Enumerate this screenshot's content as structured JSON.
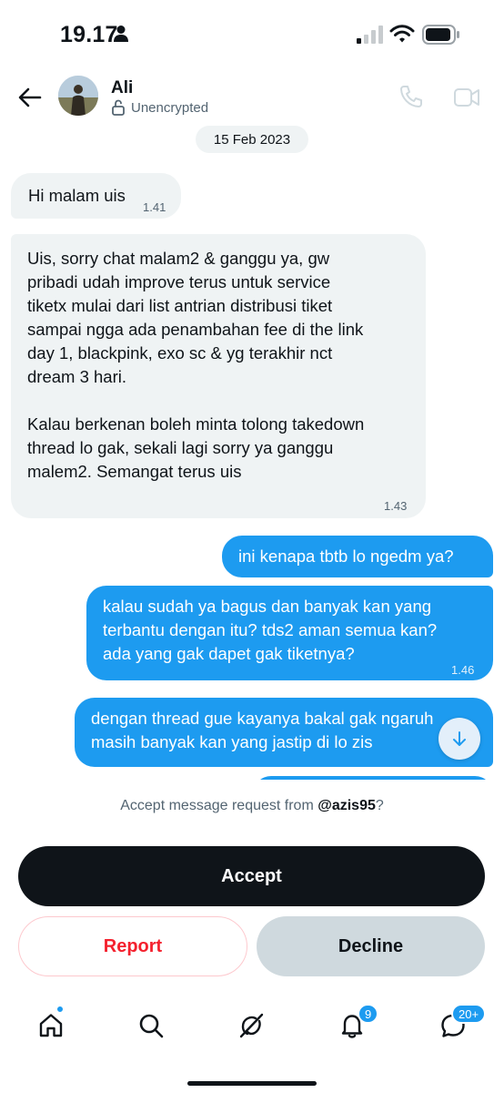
{
  "status_bar": {
    "time": "19.17",
    "icons": [
      "person-icon",
      "signal-icon",
      "wifi-icon",
      "battery-icon"
    ]
  },
  "header": {
    "name": "Ali",
    "encryption": "Unencrypted",
    "icons": [
      "back-arrow-icon",
      "avatar",
      "lock-icon",
      "phone-icon",
      "video-camera-icon"
    ]
  },
  "date_chip": "15 Feb 2023",
  "messages": [
    {
      "direction": "incoming",
      "text": "Hi malam uis",
      "time": "1.41"
    },
    {
      "direction": "incoming",
      "text": "Uis, sorry chat malam2 & ganggu ya, gw\npribadi udah improve terus untuk service\ntiketx mulai dari list antrian distribusi tiket\nsampai ngga ada penambahan fee di the link\nday 1, blackpink, exo sc & yg terakhir nct\ndream 3 hari.\n\nKalau berkenan boleh minta tolong takedown\nthread lo gak, sekali lagi sorry ya ganggu\nmalem2. Semangat terus uis",
      "time": "1.43"
    },
    {
      "direction": "outgoing",
      "text": "ini kenapa tbtb lo ngedm ya?",
      "time": ""
    },
    {
      "direction": "outgoing",
      "text": "kalau sudah ya bagus dan banyak kan yang\nterbantu dengan itu? tds2 aman semua kan?\nada yang gak dapet gak tiketnya?",
      "time": "1.46"
    },
    {
      "direction": "outgoing",
      "text": "dengan thread gue kayanya bakal gak ngaruh\nmasih banyak kan yang jastip di lo zis",
      "time": ""
    }
  ],
  "request": {
    "prefix": "Accept message request from ",
    "handle": "@azis95",
    "suffix": "?"
  },
  "buttons": {
    "accept": "Accept",
    "report": "Report",
    "decline": "Decline"
  },
  "bottom_nav": {
    "items": [
      "home-icon",
      "search-icon",
      "grok-icon",
      "bell-icon",
      "messages-icon"
    ],
    "notifications_badge": "9",
    "messages_badge": "20+"
  },
  "colors": {
    "accent": "#1d9bf0",
    "incoming_bubble": "#eff3f4",
    "accept_bg": "#0f1419",
    "report_text": "#f4212e",
    "decline_bg": "#cfd9de"
  }
}
